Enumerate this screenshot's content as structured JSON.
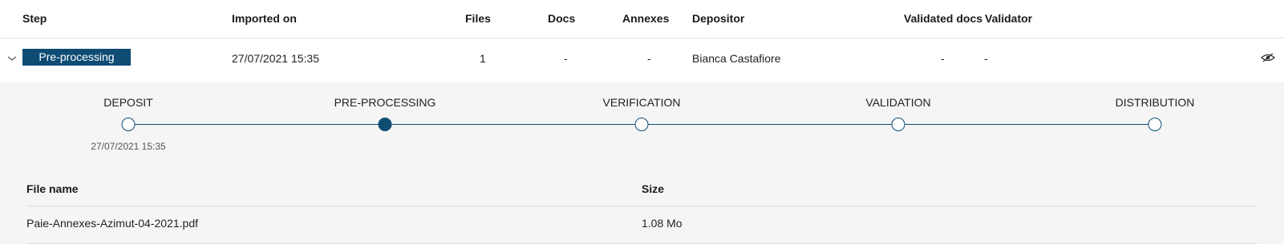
{
  "table": {
    "headers": {
      "step": "Step",
      "imported_on": "Imported on",
      "files": "Files",
      "docs": "Docs",
      "annexes": "Annexes",
      "depositor": "Depositor",
      "validated_docs": "Validated docs",
      "validator": "Validator"
    },
    "row": {
      "step": "Pre-processing",
      "imported_on": "27/07/2021 15:35",
      "files": "1",
      "docs": "-",
      "annexes": "-",
      "depositor": "Bianca Castafiore",
      "validated_docs": "-",
      "validator": "-",
      "expand_icon": "chevron-down-icon",
      "view_icon": "eye-icon"
    }
  },
  "timeline": {
    "stages": [
      {
        "label": "DEPOSIT",
        "date": "27/07/2021 15:35",
        "state": "done"
      },
      {
        "label": "PRE-PROCESSING",
        "date": "",
        "state": "current"
      },
      {
        "label": "VERIFICATION",
        "date": "",
        "state": "pending"
      },
      {
        "label": "VALIDATION",
        "date": "",
        "state": "pending"
      },
      {
        "label": "DISTRIBUTION",
        "date": "",
        "state": "pending"
      }
    ]
  },
  "files_table": {
    "headers": {
      "file_name": "File name",
      "size": "Size"
    },
    "rows": [
      {
        "file_name": "Paie-Annexes-Azimut-04-2021.pdf",
        "size": "1.08 Mo"
      }
    ]
  },
  "colors": {
    "accent": "#0f4c74",
    "detail_background": "#f5f5f5",
    "divider": "#e3e3e3"
  }
}
